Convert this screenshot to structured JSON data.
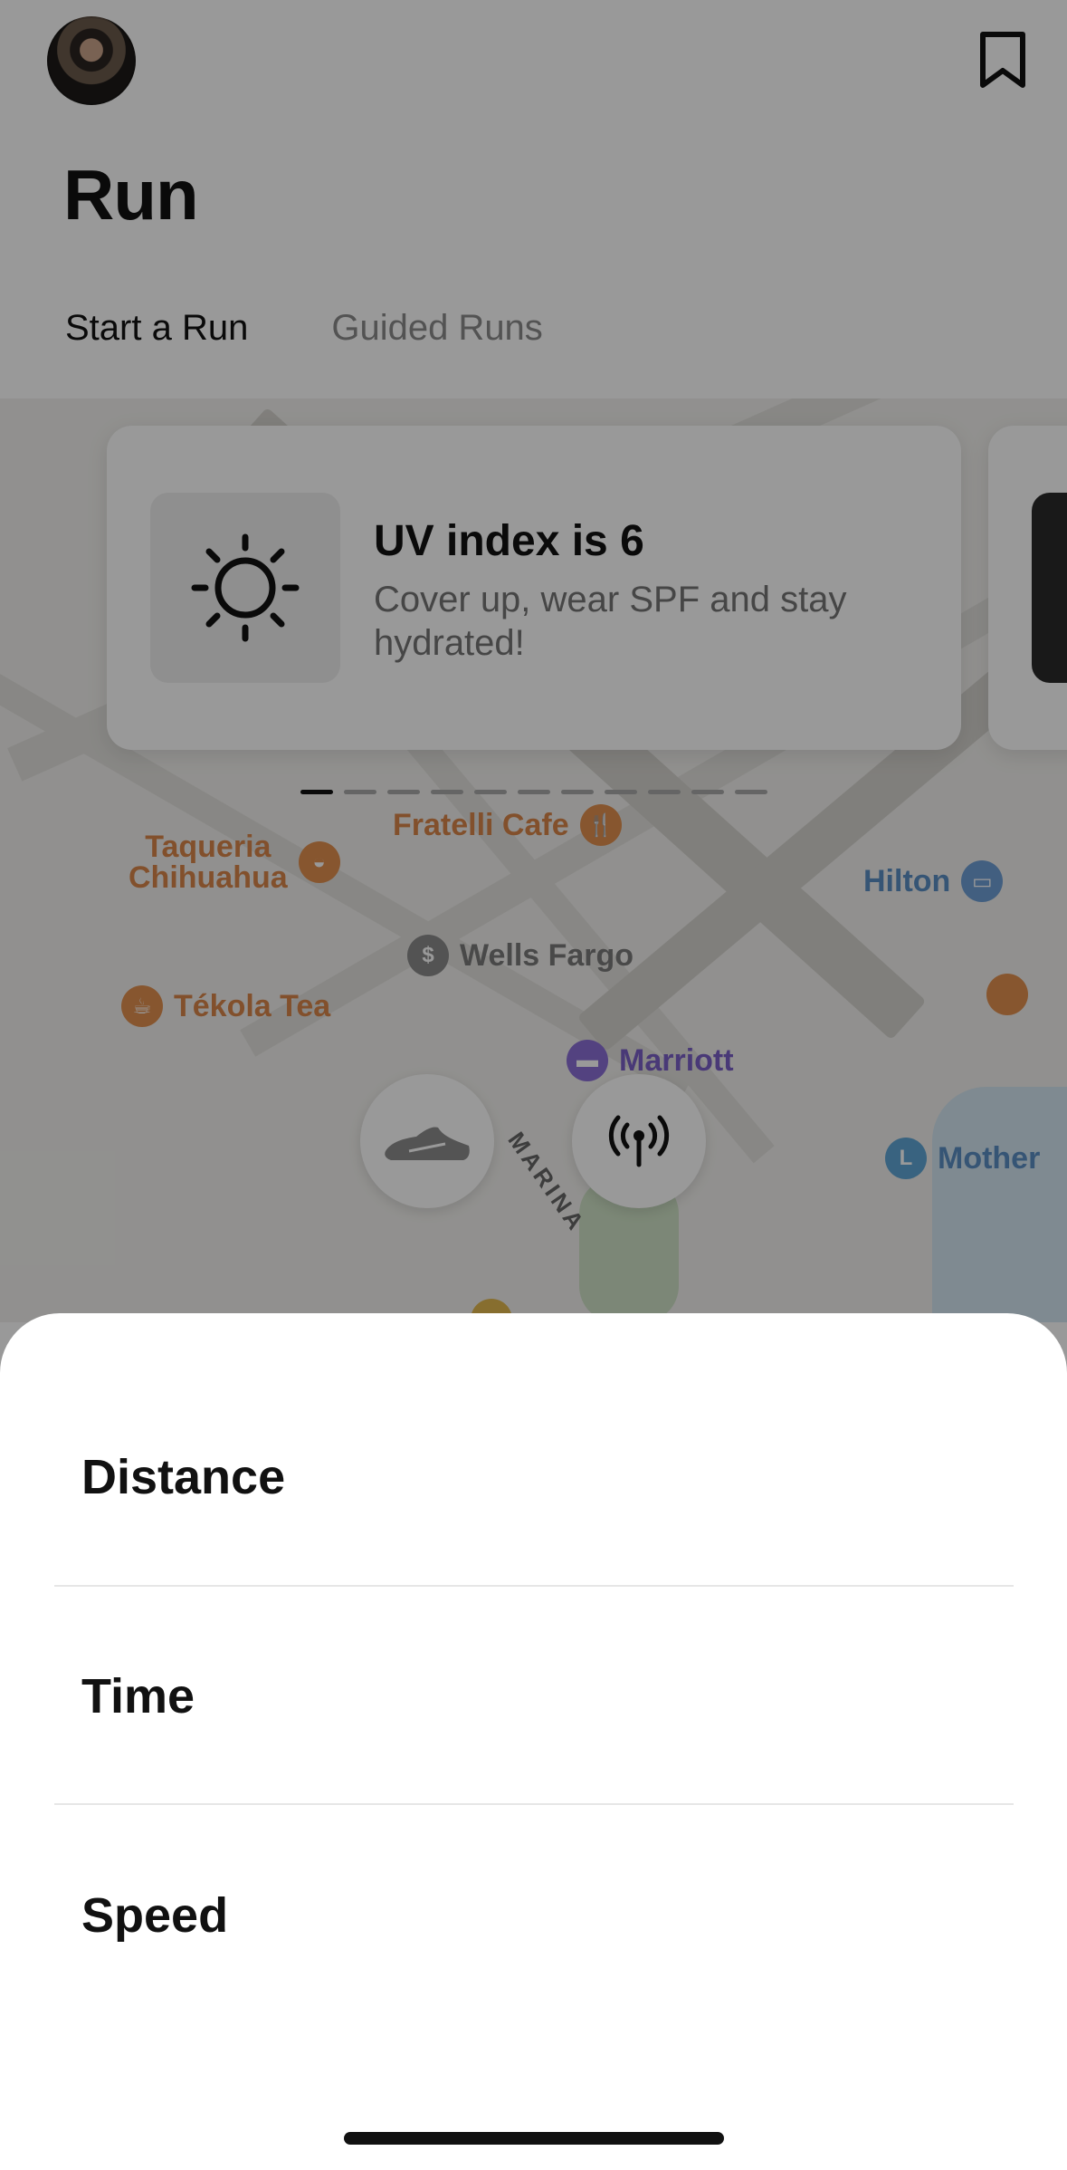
{
  "header": {
    "avatar_icon": "profile-avatar",
    "bookmark_icon": "bookmark-icon",
    "title": "Run"
  },
  "tabs": [
    {
      "label": "Start a Run",
      "active": true
    },
    {
      "label": "Guided Runs",
      "active": false
    }
  ],
  "uv_card": {
    "icon": "sun-icon",
    "title": "UV index is 6",
    "body": "Cover up, wear SPF and stay hydrated!"
  },
  "carousel": {
    "page_count": 11,
    "active_index": 0
  },
  "map": {
    "pois": [
      {
        "label": "Fratelli Cafe"
      },
      {
        "label": "Taqueria\nChihuahua"
      },
      {
        "label": "Hilton"
      },
      {
        "label": "Wells Fargo"
      },
      {
        "label": "Tékola Tea"
      },
      {
        "label": "Marriott"
      },
      {
        "label": "Mother"
      }
    ],
    "street_label": "MARINA",
    "shoe_icon": "shoe-icon",
    "signal_icon": "broadcast-icon"
  },
  "sheet": {
    "options": [
      {
        "label": "Distance"
      },
      {
        "label": "Time"
      },
      {
        "label": "Speed"
      }
    ]
  },
  "colors": {
    "overlay": "#000000",
    "map_orange": "#d9864a",
    "map_purple": "#7b5fc7"
  }
}
